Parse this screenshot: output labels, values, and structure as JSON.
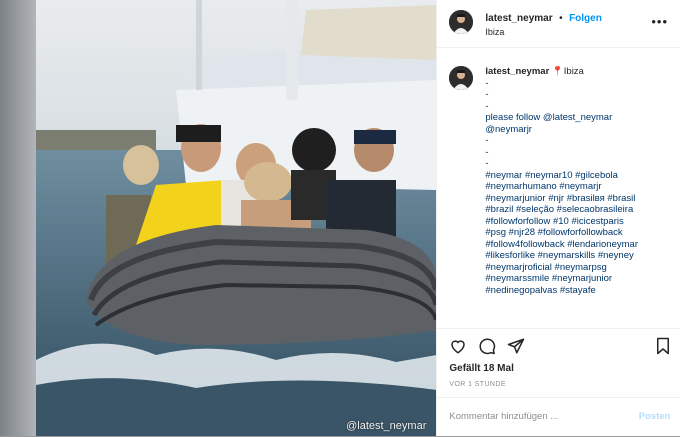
{
  "post": {
    "watermark": "@latest_neymar",
    "header": {
      "username": "latest_neymar",
      "separator": "•",
      "follow_label": "Folgen",
      "location": "Ibiza",
      "more_icon": "ellipsis-icon"
    },
    "caption": {
      "username": "latest_neymar",
      "location_emoji": "📍",
      "location": "Ibiza",
      "lines": [
        "-",
        "-",
        "-",
        "please follow @latest_neymar",
        "@neymarjr",
        "-",
        "-",
        "-",
        "#neymar #neymar10 #gilcebola",
        "#neymarhumano #neymarjr",
        "#neymarjunior #njr #brasilвя #brasil",
        "#brazil #seleção #selecaobrasileira",
        "#followforfollow #10 #icicestparis",
        "#psg #njr28 #followforfollowback",
        "#follow4followback #lendarioneymar",
        "#likesforlike #neymarskills #neyney",
        "#neymarjroficial #neymarpsg",
        "#neymarssmile #neymarjunior",
        "#nedinegopalvas #stayafe"
      ]
    },
    "actions": {
      "like_icon": "heart-icon",
      "comment_icon": "comment-icon",
      "share_icon": "share-icon",
      "save_icon": "bookmark-icon"
    },
    "likes_text": "Gefällt 18 Mal",
    "time_text": "VOR 1 STUNDE",
    "comment_placeholder": "Kommentar hinzufügen ...",
    "post_button": "Posten"
  }
}
